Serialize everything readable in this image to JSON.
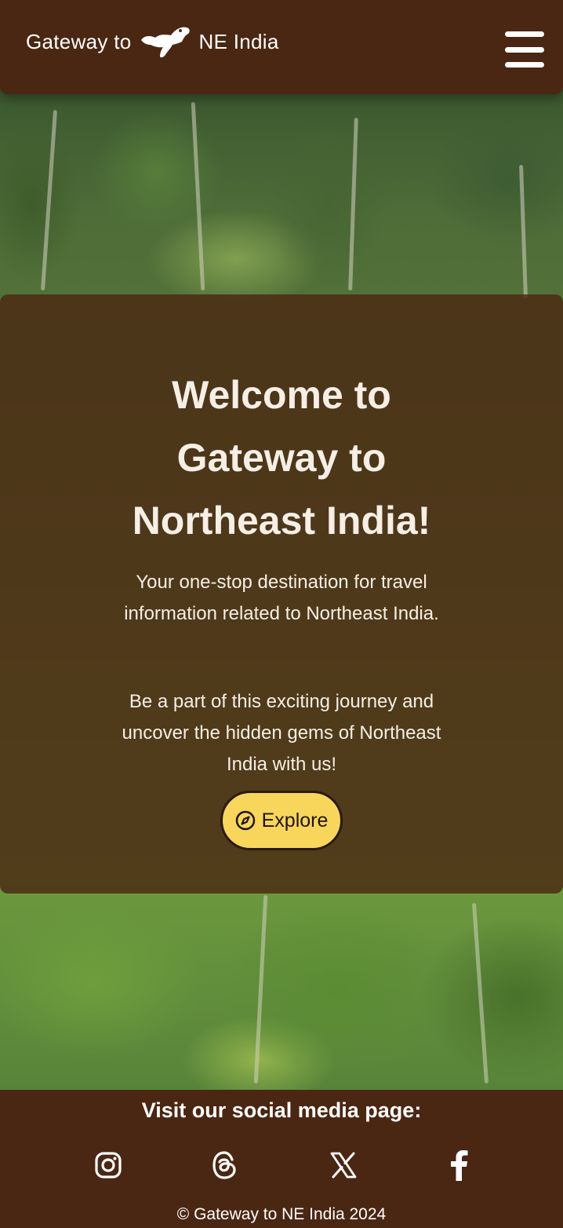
{
  "header": {
    "brand_prefix": "Gateway to",
    "brand_suffix": "NE India",
    "logo_icon": "assam-map-icon",
    "menu_icon": "hamburger-menu-icon"
  },
  "hero": {
    "title": "Welcome to Gateway to Northeast India!",
    "paragraph_1": "Your one-stop destination for travel information related to Northeast India.",
    "paragraph_2": "Be a part of this exciting journey and uncover the hidden gems of Northeast India with us!",
    "explore_label": "Explore",
    "explore_icon": "compass-icon"
  },
  "footer": {
    "social_heading": "Visit our social media page:",
    "social_icons": [
      "instagram-icon",
      "threads-icon",
      "x-icon",
      "facebook-icon"
    ],
    "copyright": "© Gateway to NE India 2024"
  },
  "colors": {
    "brown": "#4a2712",
    "button_yellow": "#f8d65b",
    "text_light": "#f6efe6"
  }
}
